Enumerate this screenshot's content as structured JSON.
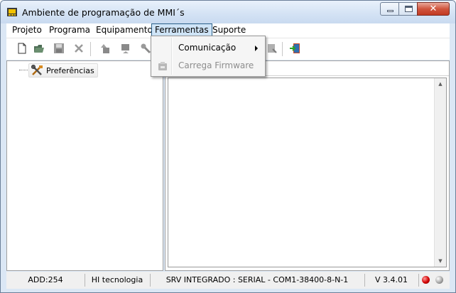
{
  "window": {
    "title": "Ambiente de programação de MMI´s",
    "controls": {
      "minimize": "",
      "maximize": "",
      "close": "✕"
    }
  },
  "menubar": {
    "items": [
      "Projeto",
      "Programa",
      "Equipamento",
      "Ferramentas",
      "Suporte"
    ],
    "open_item": "Ferramentas"
  },
  "toolbar": {
    "buttons": [
      "new-file-icon",
      "open-folder-icon",
      "save-icon",
      "cut-icon",
      "upload-icon",
      "download-icon",
      "probe-icon",
      "export-icon",
      "exit-icon"
    ]
  },
  "tree": {
    "root_label": "Preferências",
    "root_icon": "tools-icon"
  },
  "dropdown": {
    "items": [
      {
        "label": "Comunicação",
        "has_submenu": true,
        "enabled": true
      },
      {
        "label": "Carrega  Firmware",
        "has_submenu": false,
        "enabled": false,
        "icon": "firmware-icon"
      }
    ]
  },
  "statusbar": {
    "address": "ADD:254",
    "company": "HI tecnologia",
    "connection": "SRV INTEGRADO : SERIAL - COM1-38400-8-N-1",
    "version": "V 3.4.01",
    "led_colors": {
      "status": "#d10000",
      "aux": "#a8a8a8"
    }
  }
}
